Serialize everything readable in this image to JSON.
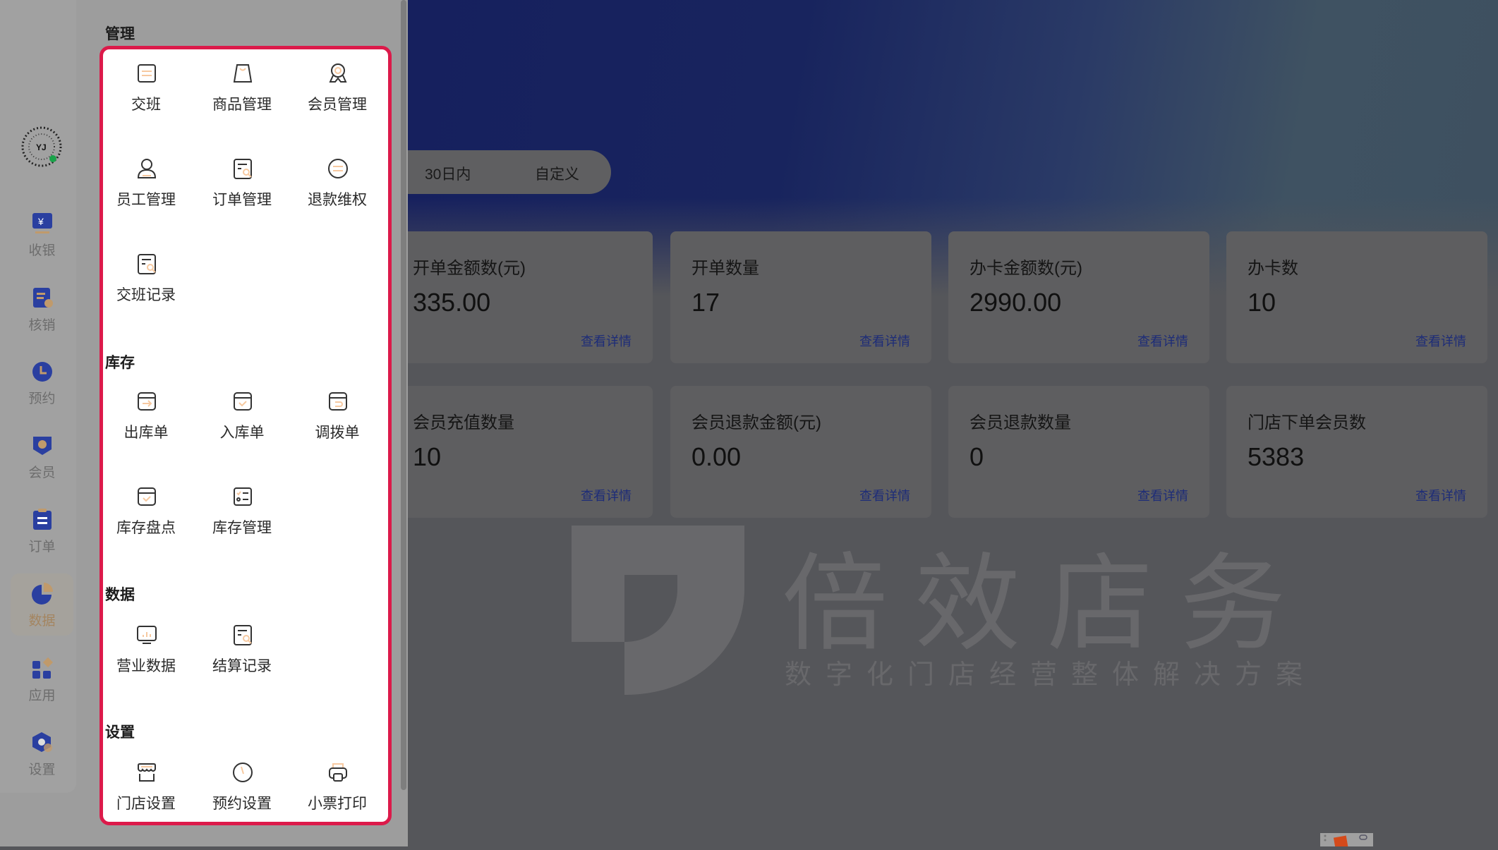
{
  "nav": {
    "items": [
      {
        "label": "收银",
        "icon": "cashier-icon"
      },
      {
        "label": "核销",
        "icon": "verify-icon"
      },
      {
        "label": "预约",
        "icon": "clock-icon"
      },
      {
        "label": "会员",
        "icon": "member-badge-icon"
      },
      {
        "label": "订单",
        "icon": "clipboard-icon"
      },
      {
        "label": "数据",
        "icon": "pie-chart-icon",
        "active": true
      },
      {
        "label": "应用",
        "icon": "apps-grid-icon"
      },
      {
        "label": "设置",
        "icon": "settings-hex-icon"
      }
    ]
  },
  "menu": {
    "sections": [
      {
        "title": "管理",
        "items": [
          {
            "label": "交班",
            "icon": "shift-swap-icon"
          },
          {
            "label": "商品管理",
            "icon": "shopping-bag-icon"
          },
          {
            "label": "会员管理",
            "icon": "award-icon"
          },
          {
            "label": "员工管理",
            "icon": "user-icon"
          },
          {
            "label": "订单管理",
            "icon": "document-search-icon"
          },
          {
            "label": "退款维权",
            "icon": "refund-circle-icon"
          },
          {
            "label": "交班记录",
            "icon": "document-search-icon"
          }
        ]
      },
      {
        "title": "库存",
        "items": [
          {
            "label": "出库单",
            "icon": "box-out-icon"
          },
          {
            "label": "入库单",
            "icon": "box-in-icon"
          },
          {
            "label": "调拨单",
            "icon": "box-transfer-icon"
          },
          {
            "label": "库存盘点",
            "icon": "box-check-icon"
          },
          {
            "label": "库存管理",
            "icon": "checklist-icon"
          }
        ]
      },
      {
        "title": "数据",
        "items": [
          {
            "label": "营业数据",
            "icon": "monitor-chart-icon"
          },
          {
            "label": "结算记录",
            "icon": "document-search-icon"
          }
        ]
      },
      {
        "title": "设置",
        "items": [
          {
            "label": "门店设置",
            "icon": "store-icon"
          },
          {
            "label": "预约设置",
            "icon": "clock-icon"
          },
          {
            "label": "小票打印",
            "icon": "printer-icon"
          }
        ]
      }
    ]
  },
  "tabs": [
    "30日内",
    "自定义"
  ],
  "cards": [
    {
      "title": "开单金额数(元)",
      "value": "335.00",
      "link": "查看详情"
    },
    {
      "title": "开单数量",
      "value": "17",
      "link": "查看详情"
    },
    {
      "title": "办卡金额数(元)",
      "value": "2990.00",
      "link": "查看详情"
    },
    {
      "title": "办卡数",
      "value": "10",
      "link": "查看详情"
    },
    {
      "title": "会员充值数量",
      "value": "10",
      "link": "查看详情"
    },
    {
      "title": "会员退款金额(元)",
      "value": "0.00",
      "link": "查看详情"
    },
    {
      "title": "会员退款数量",
      "value": "0",
      "link": "查看详情"
    },
    {
      "title": "门店下单会员数",
      "value": "5383",
      "link": "查看详情"
    }
  ],
  "watermark": {
    "title": "倍效店务",
    "subtitle": "数字化门店经营整体解决方案"
  },
  "colors": {
    "accent_red": "#dc1a4a",
    "nav_blue": "#2a3fa0",
    "nav_tan": "#c09a6b",
    "link": "#1d2c78"
  }
}
